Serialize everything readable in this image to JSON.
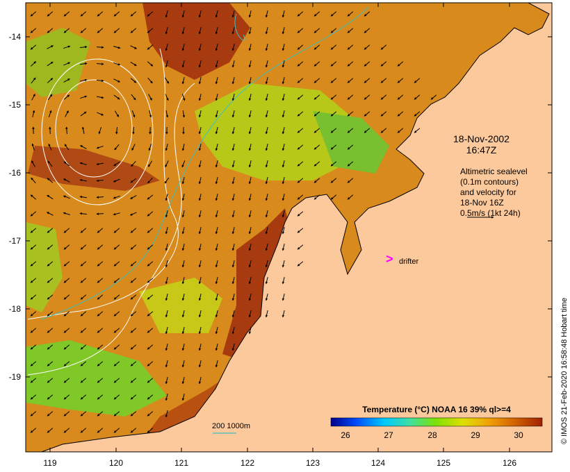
{
  "map": {
    "x_ticks": [
      "119",
      "120",
      "121",
      "122",
      "123",
      "124",
      "125",
      "126"
    ],
    "y_ticks": [
      "-14",
      "-15",
      "-16",
      "-17",
      "-18",
      "-19"
    ],
    "colors": {
      "land": "#fcc99c",
      "frame": "#000000",
      "contour_200": "#40c0c0",
      "contour_sealevel": "#ffffff",
      "drifter": "#ff00ff"
    }
  },
  "annotation": {
    "date": "18-Nov-2002",
    "time": "16:47Z",
    "altimetry_lines": [
      "Altimetric sealevel",
      "(0.1m contours)",
      "and velocity for",
      "18-Nov 16Z",
      "0.5m/s (1kt 24h)"
    ],
    "drifter_label": "drifter",
    "drifter_marker": ">",
    "contour_legend": "200  1000m"
  },
  "colorbar": {
    "title": "Temperature (°C) NOAA 16 39% ql>=4",
    "ticks": [
      "26",
      "27",
      "28",
      "29",
      "30"
    ],
    "range": [
      25.4,
      30.6
    ],
    "stops": [
      "#00008b",
      "#0050ff",
      "#00c8ff",
      "#40e0a0",
      "#80e000",
      "#e0e000",
      "#f0a000",
      "#d06000",
      "#a02000"
    ]
  },
  "credit": "© IMOS 21-Feb-2020 16:58:48 Hobart time"
}
